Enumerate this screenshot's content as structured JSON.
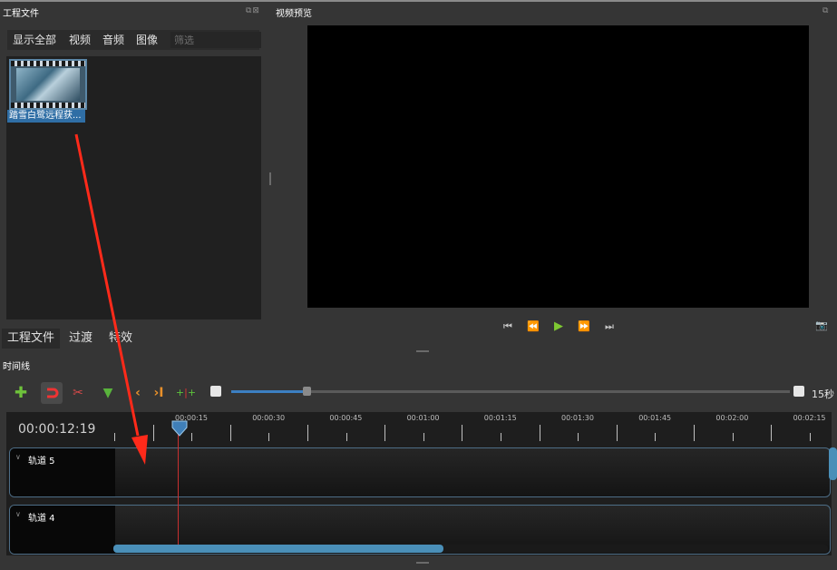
{
  "project_files": {
    "title": "工程文件",
    "filters": [
      "显示全部",
      "视频",
      "音频",
      "图像"
    ],
    "filter_placeholder": "筛选",
    "file": {
      "label": "踏雪白鹭远程获...",
      "icon": "video-thumbnail"
    }
  },
  "preview": {
    "title": "视频预览",
    "controls": [
      "jump-start-icon",
      "rewind-icon",
      "play-icon",
      "fast-forward-icon",
      "jump-end-icon"
    ],
    "play_color": "#7ec832"
  },
  "tabs": [
    "工程文件",
    "过渡",
    "特效"
  ],
  "timeline": {
    "title": "时间线",
    "timecode": "00:00:12:19",
    "zoom_label": "15秒",
    "zoom_level": 0.14,
    "ruler": [
      "00:00:15",
      "00:00:30",
      "00:00:45",
      "00:01:00",
      "00:01:15",
      "00:01:30",
      "00:01:45",
      "00:02:00",
      "00:02:15"
    ],
    "tracks": [
      {
        "name": "轨道 5"
      },
      {
        "name": "轨道 4"
      }
    ],
    "toolbar_icons": [
      "add-track-icon",
      "snap-icon",
      "razor-icon",
      "marker-icon",
      "previous-marker-icon",
      "next-marker-icon",
      "center-playhead-icon",
      "zoom-out-icon"
    ]
  },
  "colors": {
    "accent": "#3c7fc2",
    "track_border": "#4d6d86",
    "playhead": "#c83030",
    "annotation_arrow": "#ff2a1a"
  }
}
